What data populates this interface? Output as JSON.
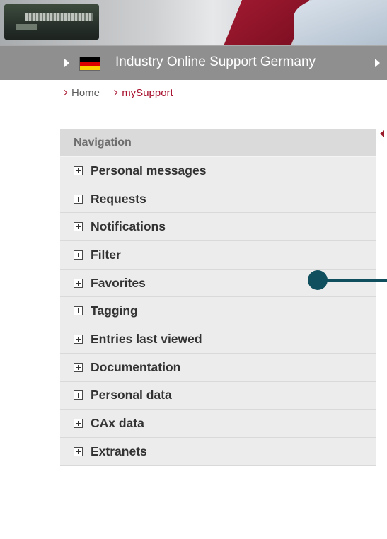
{
  "header": {
    "site_title": "Industry Online Support Germany",
    "flag_icon": "germany-flag-icon"
  },
  "breadcrumb": {
    "items": [
      "Home",
      "mySupport"
    ]
  },
  "navigation": {
    "title": "Navigation",
    "items": [
      {
        "label": "Personal messages"
      },
      {
        "label": "Requests"
      },
      {
        "label": "Notifications"
      },
      {
        "label": "Filter"
      },
      {
        "label": "Favorites"
      },
      {
        "label": "Tagging"
      },
      {
        "label": "Entries last viewed"
      },
      {
        "label": "Documentation"
      },
      {
        "label": "Personal data"
      },
      {
        "label": "CAx data"
      },
      {
        "label": "Extranets"
      }
    ]
  },
  "colors": {
    "accent": "#a8102e",
    "pointer": "#0f4f5e",
    "title_bar": "#8f8f8f"
  }
}
